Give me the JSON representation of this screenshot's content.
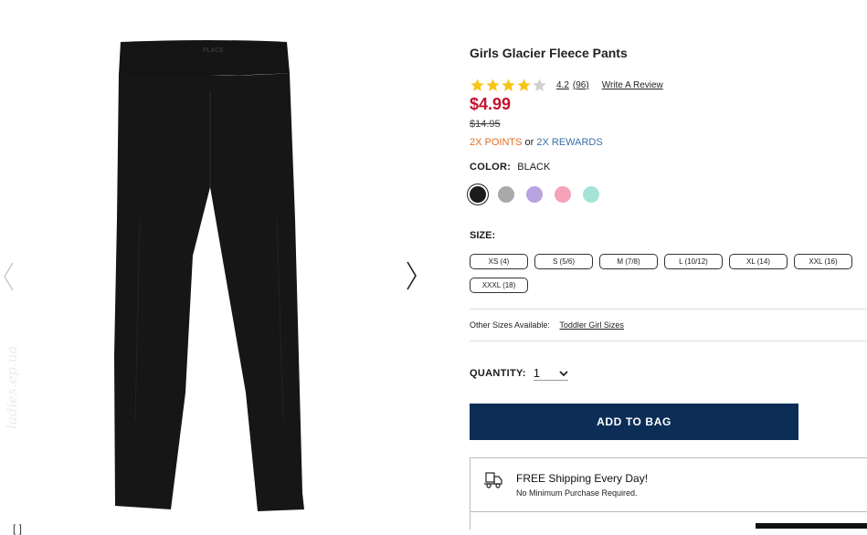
{
  "product": {
    "title": "Girls Glacier Fleece Pants",
    "rating": {
      "value": 4.2,
      "value_label": "4.2",
      "count_label": "(96)",
      "write_review": "Write A Review"
    },
    "price": "$4.99",
    "list_price": "$14.95",
    "points": {
      "first": "2X POINTS",
      "connector": "or",
      "second": "2X REWARDS"
    },
    "color": {
      "label": "COLOR:",
      "value": "BLACK"
    },
    "swatches": [
      {
        "name": "black",
        "color": "#1c1c1c",
        "selected": true
      },
      {
        "name": "gray",
        "color": "#a9a9a9",
        "selected": false
      },
      {
        "name": "lavender",
        "color": "#b8a3e0",
        "selected": false
      },
      {
        "name": "pink",
        "color": "#f5a3b8",
        "selected": false
      },
      {
        "name": "mint",
        "color": "#a5e3d8",
        "selected": false
      }
    ],
    "size": {
      "label": "SIZE:",
      "options": [
        "XS (4)",
        "S (5/6)",
        "M (7/8)",
        "L (10/12)",
        "XL (14)",
        "XXL (16)",
        "XXXL (18)"
      ]
    },
    "other_sizes": {
      "label": "Other Sizes Available:",
      "link": "Toddler Girl Sizes"
    },
    "quantity": {
      "label": "QUANTITY:",
      "value": "1"
    },
    "add_to_bag": "ADD TO BAG",
    "shipping": {
      "title": "FREE Shipping Every Day!",
      "subtitle": "No Minimum Purchase Required."
    }
  },
  "gallery": {
    "watermark": "ladies.ep.ua",
    "image_brand": "PLACE"
  },
  "colors": {
    "price": "#c4122f",
    "points": "#e36d25",
    "rewards": "#3a6fa5",
    "button": "#0c2e56",
    "star": "#f5c518"
  }
}
